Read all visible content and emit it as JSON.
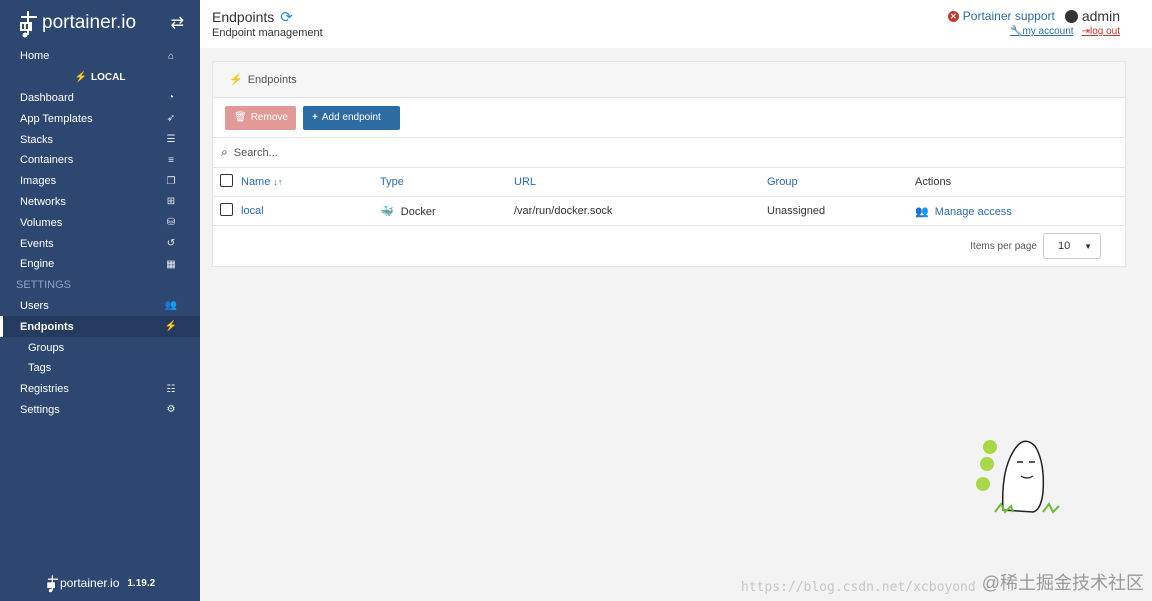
{
  "brand": {
    "name": "portainer.io"
  },
  "sidebar": {
    "home_label": "Home",
    "endpoint_section": "LOCAL",
    "items": [
      {
        "label": "Dashboard",
        "icon": "tachometer-icon"
      },
      {
        "label": "App Templates",
        "icon": "rocket-icon"
      },
      {
        "label": "Stacks",
        "icon": "th-list-icon"
      },
      {
        "label": "Containers",
        "icon": "list-icon"
      },
      {
        "label": "Images",
        "icon": "clone-icon"
      },
      {
        "label": "Networks",
        "icon": "sitemap-icon"
      },
      {
        "label": "Volumes",
        "icon": "hdd-icon"
      },
      {
        "label": "Events",
        "icon": "history-icon"
      },
      {
        "label": "Engine",
        "icon": "th-icon"
      }
    ],
    "settings_header": "SETTINGS",
    "settings_items": [
      {
        "label": "Users",
        "icon": "users-icon"
      },
      {
        "label": "Endpoints",
        "icon": "plug-icon"
      },
      {
        "label": "Groups"
      },
      {
        "label": "Tags"
      },
      {
        "label": "Registries",
        "icon": "database-icon"
      },
      {
        "label": "Settings",
        "icon": "cogs-icon"
      }
    ],
    "footer_brand": "portainer.io",
    "footer_version": "1.19.2"
  },
  "header": {
    "title": "Endpoints",
    "subtitle": "Endpoint management",
    "support_label": "Portainer support",
    "username": "admin",
    "my_account": "my account",
    "log_out": "log out"
  },
  "widget": {
    "title": "Endpoints",
    "remove_label": "Remove",
    "add_label": "Add endpoint",
    "search_placeholder": "Search...",
    "columns": {
      "name": "Name",
      "type": "Type",
      "url": "URL",
      "group": "Group",
      "actions": "Actions"
    },
    "rows": [
      {
        "name": "local",
        "type": "Docker",
        "url": "/var/run/docker.sock",
        "group": "Unassigned",
        "action": "Manage access"
      }
    ],
    "items_per_page_label": "Items per page",
    "items_per_page_value": "10"
  },
  "watermark": {
    "url": "https://blog.csdn.net/xcboyond",
    "brand": "@稀土掘金技术社区"
  },
  "colors": {
    "sidebar_bg": "#2e4770",
    "accent": "#2d6ca2",
    "danger": "#e29a98"
  }
}
